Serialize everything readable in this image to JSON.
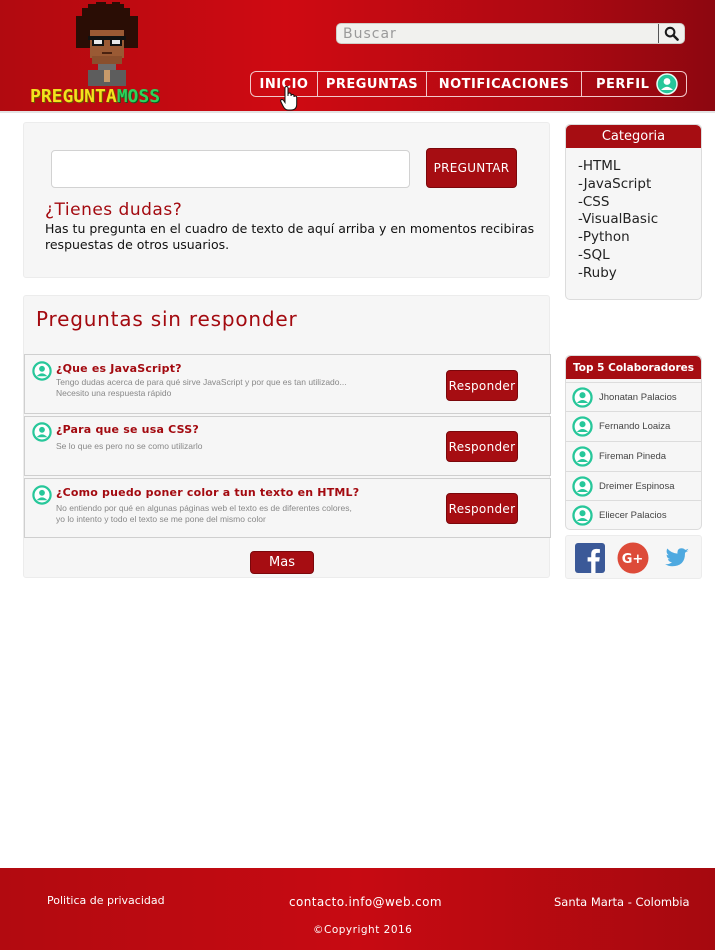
{
  "brand": {
    "logo_part1": "PREGUNTA",
    "logo_part2": "MOSS"
  },
  "search": {
    "placeholder": "Buscar"
  },
  "nav": {
    "items": [
      {
        "label": "INICIO"
      },
      {
        "label": "PREGUNTAS"
      },
      {
        "label": "NOTIFICACIONES"
      },
      {
        "label": "PERFIL"
      }
    ]
  },
  "ask": {
    "input_value": "",
    "button_label": "PREGUNTAR",
    "title": "¿Tienes dudas?",
    "description": "Has tu pregunta en el cuadro de texto de aquí arriba y en momentos recibiras respuestas de otros usuarios."
  },
  "unanswered": {
    "title": "Preguntas sin responder",
    "questions": [
      {
        "title": "¿Que es JavaScript?",
        "description": "Tengo dudas acerca de para qué sirve JavaScript y por que es tan utilizado...\nNecesito una respuesta rápido",
        "button_label": "Responder"
      },
      {
        "title": "¿Para que se usa CSS?",
        "description": "Se lo que es pero no se como utilizarlo",
        "button_label": "Responder"
      },
      {
        "title": "¿Como puedo poner color a tun texto en HTML?",
        "description": "No entiendo por qué en algunas páginas web el texto es de diferentes colores,\nyo lo intento y todo el texto se me pone del mismo color",
        "button_label": "Responder"
      }
    ],
    "more_label": "Mas"
  },
  "categories": {
    "title": "Categoria",
    "items": [
      "-HTML",
      "-JavaScript",
      "-CSS",
      "-VisualBasic",
      "-Python",
      "-SQL",
      "-Ruby"
    ]
  },
  "top_collaborators": {
    "title": "Top 5 Colaboradores",
    "items": [
      "Jhonatan Palacios",
      "Fernando Loaiza",
      "Fireman Pineda",
      "Dreimer Espinosa",
      "Eliecer Palacios"
    ]
  },
  "social": {
    "icons": [
      "facebook-icon",
      "google-plus-icon",
      "twitter-icon"
    ],
    "colors": {
      "facebook": "#3b5998",
      "google_plus": "#dd4b39",
      "twitter": "#4ea9e0"
    }
  },
  "footer": {
    "privacy": "Politica de privacidad",
    "contact": "contacto.info@web.com",
    "location": "Santa Marta - Colombia",
    "copyright": "©Copyright 2016"
  },
  "colors": {
    "primary_red": "#a60d12",
    "header_red": "#cf0a12",
    "accent_teal": "#27c79a",
    "logo_yellow": "#f4e11e",
    "logo_green": "#2fd15a"
  }
}
